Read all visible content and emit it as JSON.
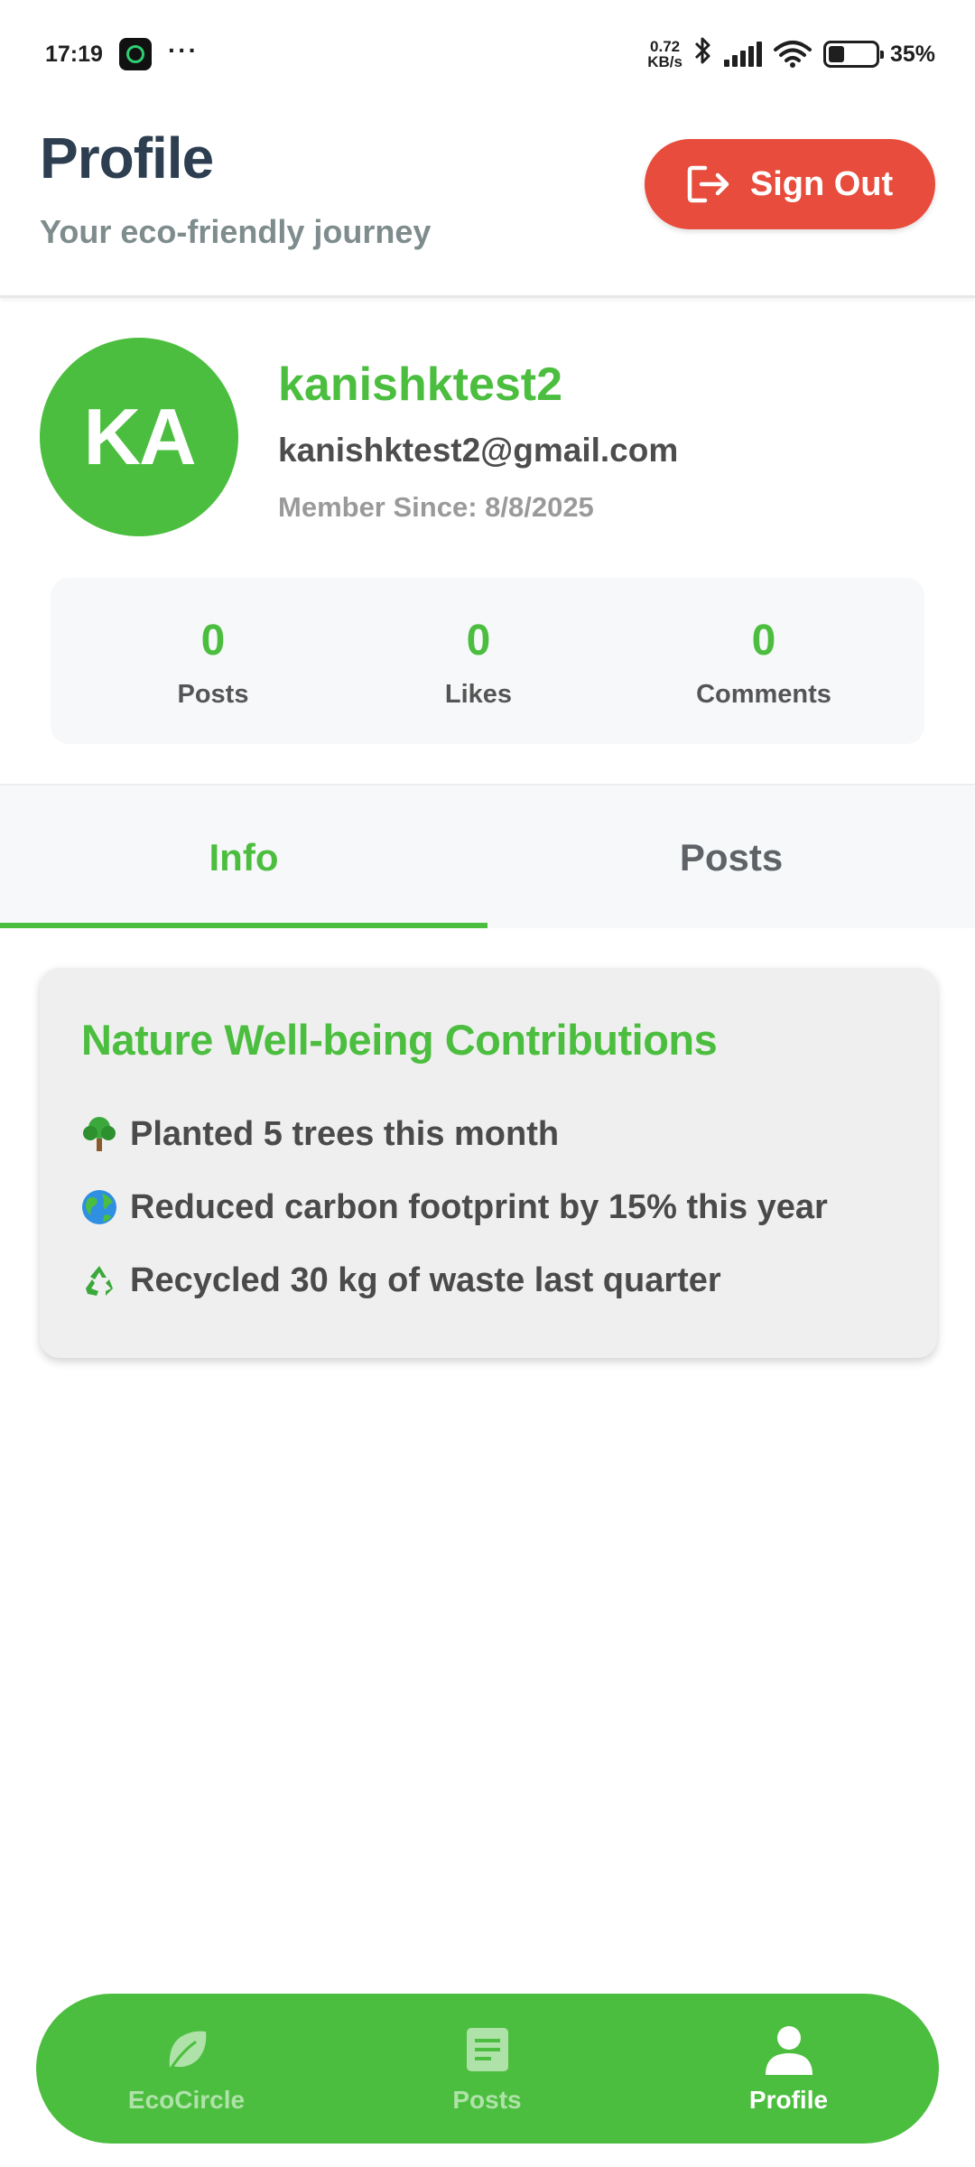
{
  "status_bar": {
    "time": "17:19",
    "more": "···",
    "net_speed_value": "0.72",
    "net_speed_unit": "KB/s",
    "battery": "35%",
    "icons": [
      "whatsapp-icon",
      "bluetooth-icon",
      "signal-icon",
      "wifi-icon",
      "battery-icon"
    ]
  },
  "header": {
    "title": "Profile",
    "subtitle": "Your eco-friendly journey",
    "sign_out_label": "Sign Out"
  },
  "profile": {
    "avatar_initials": "KA",
    "username": "kanishktest2",
    "email": "kanishktest2@gmail.com",
    "member_since": "Member Since: 8/8/2025"
  },
  "stats": [
    {
      "value": "0",
      "label": "Posts"
    },
    {
      "value": "0",
      "label": "Likes"
    },
    {
      "value": "0",
      "label": "Comments"
    }
  ],
  "tabs": [
    {
      "label": "Info",
      "active": true
    },
    {
      "label": "Posts",
      "active": false
    }
  ],
  "contributions": {
    "title": "Nature Well-being Contributions",
    "items": [
      {
        "icon": "tree-icon",
        "emoji": "🌳",
        "text": "Planted 5 trees this month"
      },
      {
        "icon": "globe-icon",
        "emoji": "🌍",
        "text": "Reduced carbon footprint by 15% this year"
      },
      {
        "icon": "recycle-icon",
        "emoji": "♻️",
        "text": "Recycled 30 kg of waste last quarter"
      }
    ]
  },
  "bottom_nav": [
    {
      "label": "EcoCircle",
      "icon": "leaf-icon",
      "active": false
    },
    {
      "label": "Posts",
      "icon": "document-icon",
      "active": false
    },
    {
      "label": "Profile",
      "icon": "person-icon",
      "active": true
    }
  ],
  "colors": {
    "brand_green": "#4cbe3f",
    "danger_red": "#e74c3c",
    "title_dark": "#2c3e50",
    "subtitle_gray": "#7f8c8d"
  }
}
